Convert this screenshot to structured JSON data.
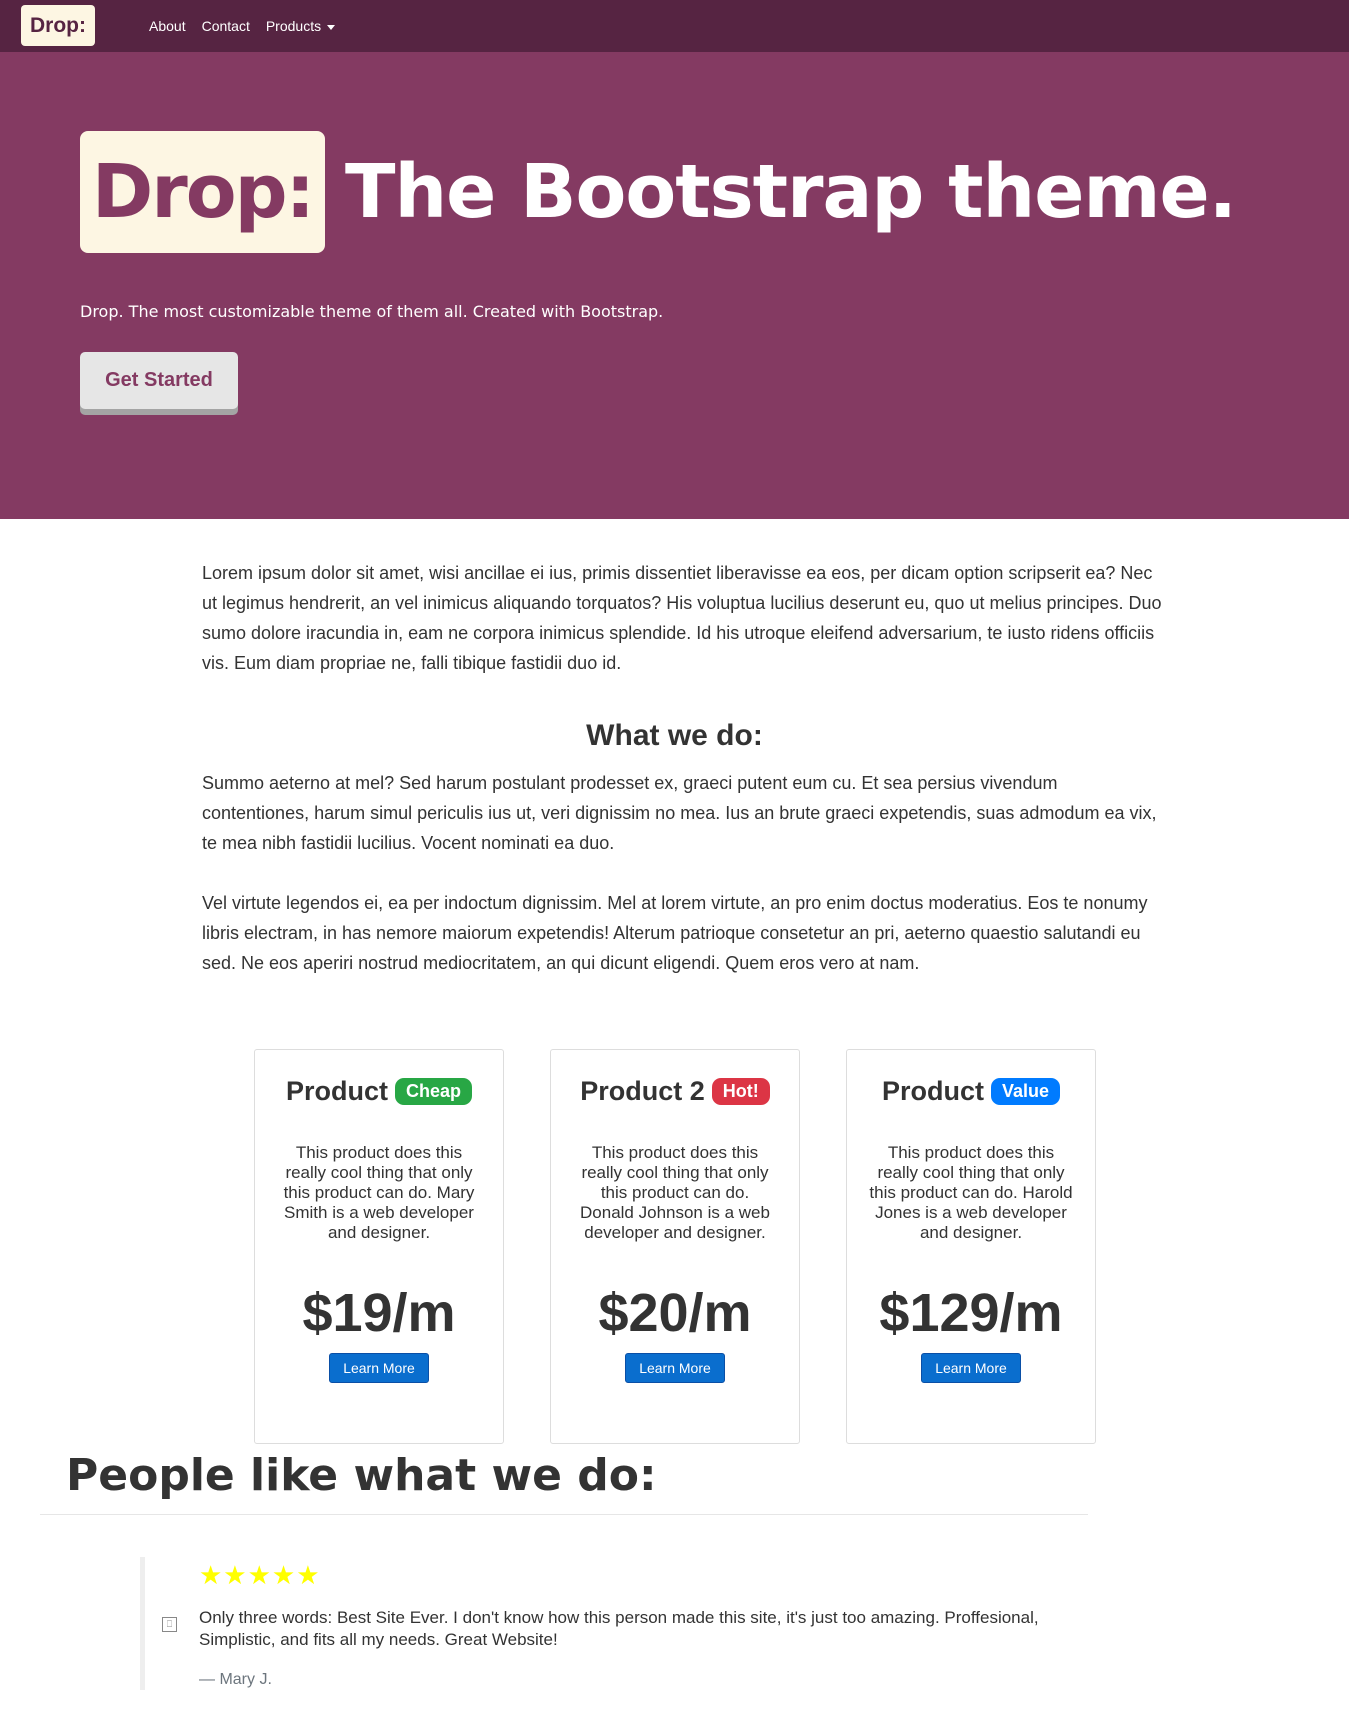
{
  "navbar": {
    "brand": "Drop:",
    "links": [
      "About",
      "Contact",
      "Products"
    ]
  },
  "hero": {
    "badge": "Drop:",
    "title": "The Bootstrap theme.",
    "subtitle": "Drop. The most customizable theme of them all. Created with Bootstrap.",
    "cta_label": "Get Started"
  },
  "intro": "Lorem ipsum dolor sit amet, wisi ancillae ei ius, primis dissentiet liberavisse ea eos, per dicam option scripserit ea? Nec ut legimus hendrerit, an vel inimicus aliquando torquatos? His voluptua lucilius deserunt eu, quo ut melius principes. Duo sumo dolore iracundia in, eam ne corpora inimicus splendide. Id his utroque eleifend adversarium, te iusto ridens officiis vis. Eum diam propriae ne, falli tibique fastidii duo id.",
  "what": {
    "title": "What we do:",
    "para1": "Summo aeterno at mel? Sed harum postulant prodesset ex, graeci putent eum cu. Et sea persius vivendum contentiones, harum simul periculis ius ut, veri dignissim no mea. Ius an brute graeci expetendis, suas admodum ea vix, te mea nibh fastidii lucilius. Vocent nominati ea duo.",
    "para2": "Vel virtute legendos ei, ea per indoctum dignissim. Mel at lorem virtute, an pro enim doctus moderatius. Eos te nonumy libris electram, in has nemore maiorum expetendis! Alterum patrioque consetetur an pri, aeterno quaestio salutandi eu sed. Ne eos aperiri nostrud mediocritatem, an qui dicunt eligendi. Quem eros vero at nam."
  },
  "products": [
    {
      "name": "Product",
      "badge": "Cheap",
      "badge_color": "#28a745",
      "desc": "This product does this really cool thing that only this product can do. Mary Smith is a web developer and designer.",
      "price": "$19/m",
      "button": "Learn More"
    },
    {
      "name": "Product 2",
      "badge": "Hot!",
      "badge_color": "#dc3545",
      "desc": "This product does this really cool thing that only this product can do. Donald Johnson is a web developer and designer.",
      "price": "$20/m",
      "button": "Learn More"
    },
    {
      "name": "Product",
      "badge": "Value",
      "badge_color": "#007bff",
      "desc": "This product does this really cool thing that only this product can do. Harold Jones is a web developer and designer.",
      "price": "$129/m",
      "button": "Learn More"
    }
  ],
  "testimonials": {
    "title": "People like what we do:",
    "stars": "★★★★★",
    "rating": 5,
    "quote": "Only three words: Best Site Ever. I don't know how this person made this site, it's just too amazing. Proffesional, Simplistic, and fits all my needs. Great Website!",
    "author": "— Mary J."
  },
  "colors": {
    "navbar": "#562442",
    "hero": "#843a62",
    "brand_bg": "#fdf6e3"
  }
}
